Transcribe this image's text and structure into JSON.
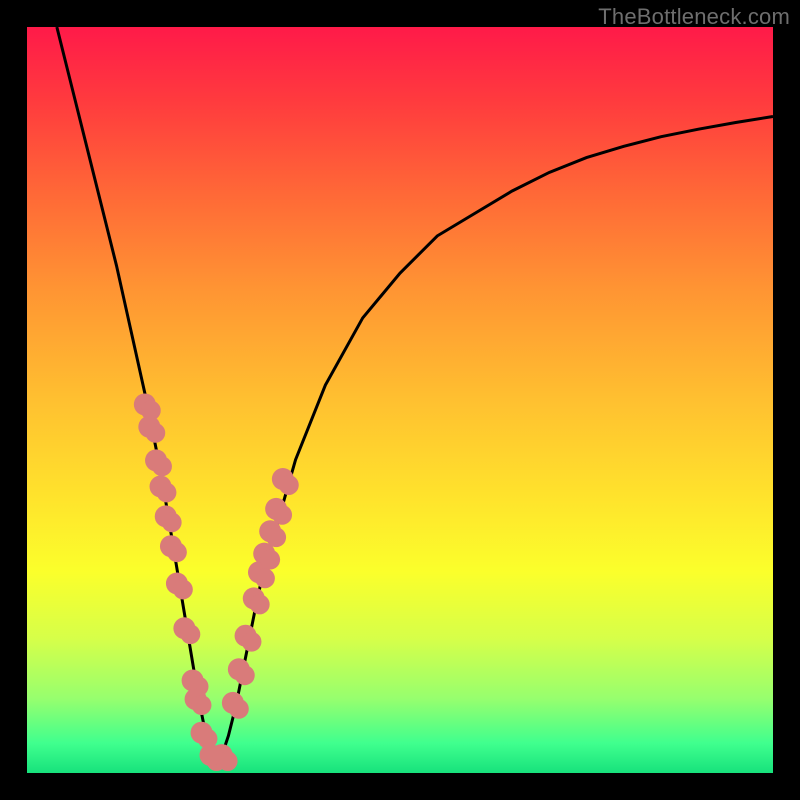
{
  "watermark": "TheBottleneck.com",
  "chart_data": {
    "type": "line",
    "title": "",
    "xlabel": "",
    "ylabel": "",
    "xlim": [
      0,
      100
    ],
    "ylim": [
      0,
      100
    ],
    "curve": {
      "description": "V-shaped bottleneck curve with minimum near x≈25",
      "x": [
        4,
        6,
        8,
        10,
        12,
        14,
        16,
        18,
        19,
        20,
        21,
        22,
        23,
        24,
        25,
        26,
        27,
        28,
        29,
        30,
        31,
        32,
        34,
        36,
        40,
        45,
        50,
        55,
        60,
        65,
        70,
        75,
        80,
        85,
        90,
        95,
        100
      ],
      "y": [
        100,
        92,
        84,
        76,
        68,
        59,
        50,
        40,
        34,
        28,
        22,
        16,
        10,
        5,
        2,
        2,
        5,
        9,
        14,
        19,
        24,
        28,
        35,
        42,
        52,
        61,
        67,
        72,
        75,
        78,
        80.5,
        82.5,
        84,
        85.3,
        86.3,
        87.2,
        88
      ]
    },
    "series": [
      {
        "name": "left-branch-markers",
        "type": "scatter",
        "x": [
          16.2,
          16.8,
          17.7,
          18.3,
          19.0,
          19.7,
          20.5,
          21.5,
          22.6,
          23.0,
          23.8,
          25.0,
          26.5
        ],
        "y": [
          49.0,
          46.0,
          41.5,
          38.0,
          34.0,
          30.0,
          25.0,
          19.0,
          12.0,
          9.5,
          5.0,
          2.0,
          2.0
        ]
      },
      {
        "name": "right-branch-markers",
        "type": "scatter",
        "x": [
          28.0,
          28.8,
          29.7,
          30.8,
          31.5,
          32.2,
          33.0,
          33.8,
          34.7
        ],
        "y": [
          9.0,
          13.5,
          18.0,
          23.0,
          26.5,
          29.0,
          32.0,
          35.0,
          39.0
        ]
      }
    ],
    "dot_radius_main": 11,
    "dot_radius_pair_offset": 6
  },
  "colors": {
    "dot": "#d97b7a",
    "curve": "#000000",
    "watermark": "#6e6e6e"
  }
}
